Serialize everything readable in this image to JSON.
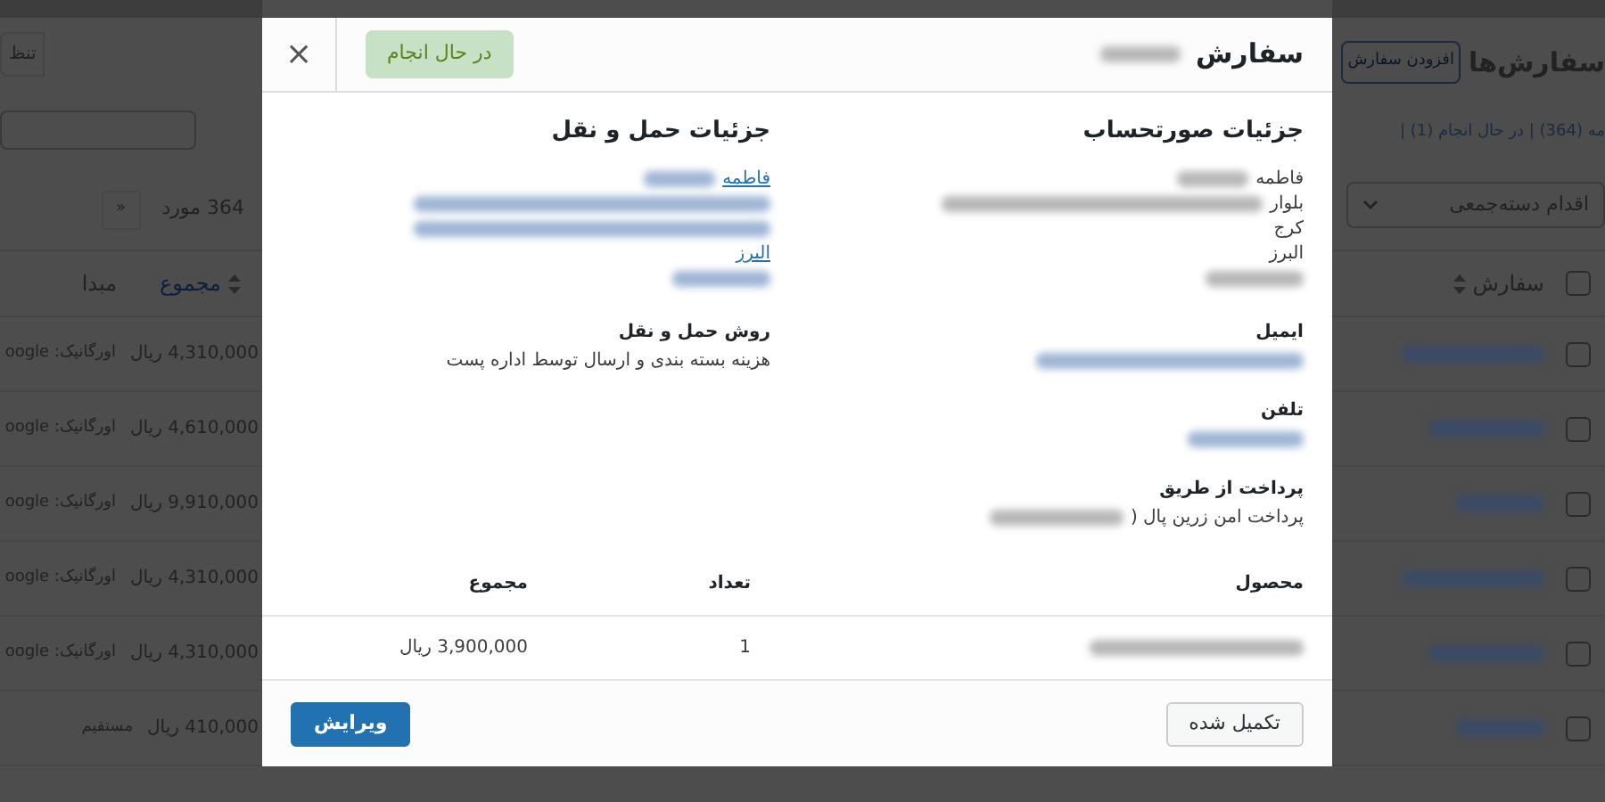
{
  "background": {
    "page_title": "سفارش‌ها",
    "add_button": "افزودن سفارش",
    "status_filters": "مه (364) | در حال انجام (1) |",
    "header_checked": false,
    "bulk_action": "اقدام دسته‌جمعی",
    "screen_options_button": "تنظ",
    "items_count": "364 مورد",
    "pagination_first": "«",
    "order_column": {
      "label": "سفارش",
      "sortable": true
    },
    "left_columns": [
      {
        "label": "مجموع",
        "sortable": true
      },
      {
        "label": "مبدا",
        "sortable": false
      }
    ],
    "rows": [
      {
        "checked": false,
        "total": "4,310,000 ریال",
        "origin": "اورگانیک: oogle"
      },
      {
        "checked": false,
        "total": "4,610,000 ریال",
        "origin": "اورگانیک: oogle"
      },
      {
        "checked": false,
        "total": "9,910,000 ریال",
        "origin": "اورگانیک: oogle"
      },
      {
        "checked": false,
        "total": "4,310,000 ریال",
        "origin": "اورگانیک: oogle"
      },
      {
        "checked": false,
        "total": "4,310,000 ریال",
        "origin": "اورگانیک: oogle"
      },
      {
        "checked": false,
        "total": "410,000 ریال",
        "origin": "مستقیم"
      }
    ]
  },
  "modal": {
    "title": "سفارش",
    "status": {
      "label": "در حال انجام",
      "kind": "processing"
    },
    "close": "×",
    "billing": {
      "heading": "جزئیات صورتحساب",
      "address": [
        {
          "text": "فاطمه",
          "redacted": true
        },
        {
          "text": "بلوار",
          "redacted": true
        },
        {
          "text": "کرج",
          "redacted": false
        },
        {
          "text": "البرز",
          "redacted": false
        },
        {
          "redacted": true
        }
      ],
      "fields": [
        {
          "label": "ایمیل",
          "kind": "link"
        },
        {
          "label": "تلفن",
          "kind": "link"
        },
        {
          "label": "پرداخت از طریق",
          "kind": "text",
          "value": "پرداخت امن زرین پال ("
        }
      ]
    },
    "shipping": {
      "heading": "جزئیات حمل و نقل",
      "address": [
        {
          "text": "فاطمه",
          "redacted": true
        },
        {
          "redacted": true
        },
        {
          "redacted": true
        },
        {
          "text": "البرز",
          "redacted": false
        },
        {
          "redacted": true
        }
      ],
      "method_label": "روش حمل و نقل",
      "method": "هزینه بسته بندی و ارسال توسط اداره پست"
    },
    "items": {
      "columns": [
        "محصول",
        "تعداد",
        "مجموع"
      ],
      "rows": [
        {
          "quantity": "1",
          "total": "3,900,000 ریال"
        }
      ]
    },
    "actions": [
      {
        "label": "تکمیل شده",
        "kind": "secondary"
      },
      {
        "label": "ویرایش",
        "kind": "primary"
      }
    ]
  }
}
